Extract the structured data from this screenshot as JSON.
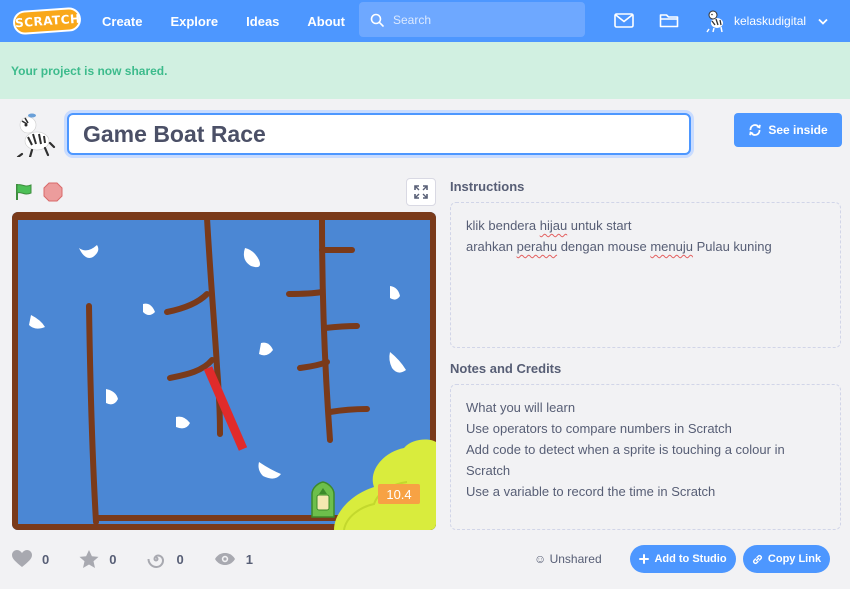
{
  "nav": {
    "logo_text": "SCRATCH",
    "links": [
      "Create",
      "Explore",
      "Ideas",
      "About"
    ],
    "search_placeholder": "Search",
    "username": "kelaskudigital"
  },
  "banner": {
    "message": "Your project is now shared."
  },
  "project": {
    "title": "Game Boat Race",
    "see_inside_label": "See inside",
    "timer_value": "10.4"
  },
  "instructions": {
    "heading": "Instructions",
    "lines": [
      [
        "klik bendera ",
        "hijau",
        " untuk start"
      ],
      [
        "arahkan ",
        "perahu",
        " dengan mouse ",
        "menuju",
        " Pulau kuning"
      ]
    ]
  },
  "notes": {
    "heading": "Notes and Credits",
    "lines": [
      "What you will learn",
      "Use operators to compare numbers in Scratch",
      "Add code to detect when a sprite is touching a colour in",
      "Scratch",
      "Use a variable to record the time in Scratch"
    ]
  },
  "stats": {
    "loves": "0",
    "favorites": "0",
    "remixes": "0",
    "views": "1"
  },
  "footer": {
    "share_status": "Unshared",
    "add_to_studio_label": "Add to Studio",
    "copy_link_label": "Copy Link"
  },
  "colors": {
    "brand_blue": "#4d97ff",
    "banner_bg": "#d1f0e1",
    "banner_text": "#3dbb8c",
    "scratch_orange": "#f9a81a"
  }
}
